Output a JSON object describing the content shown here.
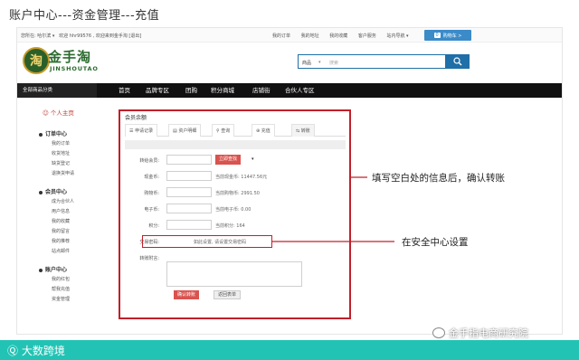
{
  "slide": {
    "title": "账户中心---资金管理---充值"
  },
  "topbar": {
    "region": "您所在: 哈尔滨 ▾",
    "welcome": "欢迎 hhr99576 , 欢迎来到金手淘 [退出]",
    "links": [
      "我的订单",
      "我的地址",
      "我的收藏",
      "客户服务",
      "站内导航 ▾"
    ],
    "cart_count": "0",
    "cart_label": "购物车 >"
  },
  "header": {
    "logo_badge": "淘",
    "logo_cn": "金手淘",
    "logo_en": "JINSHOUTAO",
    "search_category": "商品",
    "search_caret": "▾",
    "search_placeholder": "搜索"
  },
  "nav": {
    "all_categories": "全部商品分类",
    "items": [
      "首页",
      "品牌专区",
      "团购",
      "积分商城",
      "店铺街",
      "合伙人专区"
    ]
  },
  "sidebar": {
    "home": "个人主页",
    "sections": [
      {
        "title": "订单中心",
        "items": [
          "我的订单",
          "收货地址",
          "缺货登记",
          "退换货申请"
        ]
      },
      {
        "title": "会员中心",
        "items": [
          "成为合伙人",
          "用户信息",
          "我的收藏",
          "我的留言",
          "我的推荐",
          "站点邮件"
        ]
      },
      {
        "title": "账户中心",
        "items": [
          "我的红包",
          "帮我充值",
          "资金管理"
        ]
      }
    ]
  },
  "content": {
    "title": "会员余额",
    "tabs": [
      "申请记录",
      "资户明细",
      "查询",
      "充值",
      "转账"
    ],
    "form": {
      "to_member_label": "转给会员:",
      "confirm_member_btn": "立即查找",
      "caret": "▾",
      "cash_label": "现金币:",
      "cash_hint": "当前现金币: 11447.56元",
      "shopping_label": "购物币:",
      "shopping_hint": "当前购物币: 2991.50",
      "ecoin_label": "电子币:",
      "ecoin_hint": "当前电子币: 0.00",
      "points_label": "积分:",
      "points_hint": "当前积分: 164",
      "pwd_label": "交易密码:",
      "pwd_hint": "如此设置, 请设置交易密码",
      "remark_label": "转账附言:",
      "submit_btn": "确认转账",
      "back_btn": "返回表单"
    }
  },
  "annotations": {
    "fill_hint": "填写空白处的信息后，确认转账",
    "security_hint": "在安全中心设置"
  },
  "footer": {
    "brand": "大数跨境",
    "watermark": "金手指电商研究院"
  },
  "colors": {
    "accent_red": "#c0202a",
    "nav_bg": "#111111",
    "brand_teal": "#22c3b4",
    "search_blue": "#1f6fa8"
  }
}
